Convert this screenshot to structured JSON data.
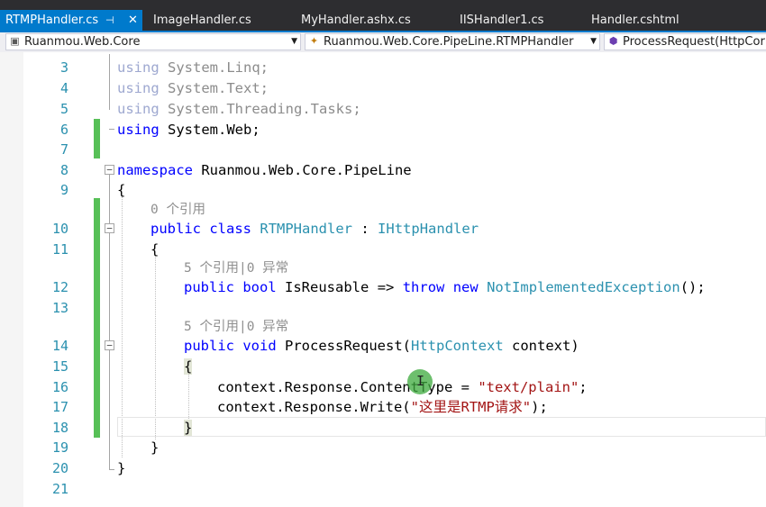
{
  "tabs": [
    {
      "label": "RTMPHandler.cs",
      "active": true,
      "pin": "⊣",
      "close": "✕"
    },
    {
      "label": "ImageHandler.cs",
      "active": false
    },
    {
      "label": "MyHandler.ashx.cs",
      "active": false
    },
    {
      "label": "IISHandler1.cs",
      "active": false
    },
    {
      "label": "Handler.cshtml",
      "active": false
    }
  ],
  "nav": {
    "project": "Ruanmou.Web.Core",
    "class": "Ruanmou.Web.Core.PipeLine.RTMPHandler",
    "member": "ProcessRequest(HttpCor"
  },
  "lines": [
    "3",
    "4",
    "5",
    "6",
    "7",
    "8",
    "9",
    "10",
    "11",
    "12",
    "13",
    "14",
    "15",
    "16",
    "17",
    "18",
    "19",
    "20",
    "21"
  ],
  "code": {
    "l3_kw": "using",
    "l3_ns": "System.Linq;",
    "l4_kw": "using",
    "l4_ns": "System.Text;",
    "l5_kw": "using",
    "l5_ns": "System.Threading.Tasks;",
    "l6_kw": "using",
    "l6_ns": "System.Web;",
    "l8_kw": "namespace",
    "l8_ns": "Ruanmou.Web.Core.PipeLine",
    "l9": "{",
    "lens10": "0 个引用",
    "l10_kw1": "public",
    "l10_kw2": "class",
    "l10_t1": "RTMPHandler",
    "l10_colon": ":",
    "l10_t2": "IHttpHandler",
    "l11": "{",
    "lens12": "5 个引用|0 异常",
    "l12_kw1": "public",
    "l12_kw2": "bool",
    "l12_name": "IsReusable",
    "l12_arrow": "=>",
    "l12_kw3": "throw",
    "l12_kw4": "new",
    "l12_t": "NotImplementedException",
    "l12_end": "();",
    "lens14": "5 个引用|0 异常",
    "l14_kw1": "public",
    "l14_kw2": "void",
    "l14_name": "ProcessRequest(",
    "l14_t": "HttpContext",
    "l14_rest": "context)",
    "l15": "{",
    "l16_a": "context.Response.ContentType =",
    "l16_str": "\"text/plain\"",
    "l16_end": ";",
    "l17_a": "context.Response.Write(",
    "l17_str": "\"这里是RTMP请求\"",
    "l17_end": ");",
    "l18": "}",
    "l19": "}",
    "l20": "}"
  },
  "colors": {
    "accent": "#007acc",
    "keyword": "#0000ff",
    "type": "#2b91af",
    "string": "#a31515",
    "changebar": "#57c057"
  },
  "icons": {
    "cursor": "I"
  }
}
